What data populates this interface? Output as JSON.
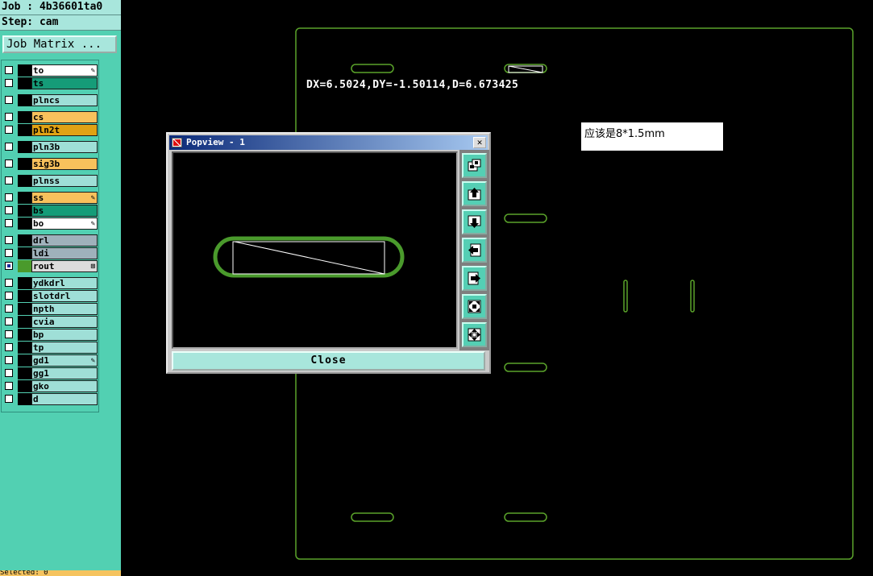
{
  "panel": {
    "job": "Job : 4b36601ta0",
    "step": "Step: cam",
    "job_matrix_label": "Job Matrix ...",
    "bottom_text": "Selected: 0"
  },
  "layers": [
    {
      "name": "to",
      "color": "#ffffff",
      "mark": "✎",
      "checked": false
    },
    {
      "name": "ts",
      "color": "#159c78",
      "mark": "",
      "checked": false
    },
    {
      "name": "plncs",
      "color": "#9fdfd7",
      "mark": "",
      "checked": false
    },
    {
      "name": "cs",
      "color": "#f8c15c",
      "mark": "",
      "checked": false
    },
    {
      "name": "pln2t",
      "color": "#e0a214",
      "mark": "",
      "checked": false
    },
    {
      "name": "pln3b",
      "color": "#9fdfd7",
      "mark": "",
      "checked": false
    },
    {
      "name": "sig3b",
      "color": "#f8c15c",
      "mark": "",
      "checked": false
    },
    {
      "name": "plnss",
      "color": "#9fdfd7",
      "mark": "",
      "checked": false
    },
    {
      "name": "ss",
      "color": "#f8c15c",
      "mark": "✎",
      "checked": false
    },
    {
      "name": "bs",
      "color": "#159c78",
      "mark": "",
      "checked": false
    },
    {
      "name": "bo",
      "color": "#ffffff",
      "mark": "✎",
      "checked": false
    },
    {
      "name": "drl",
      "color": "#9fb1bb",
      "mark": "",
      "checked": false
    },
    {
      "name": "ldi",
      "color": "#9fb1bb",
      "mark": "",
      "checked": false
    },
    {
      "name": "rout",
      "color": "#dcdcdc",
      "mark": "⊞",
      "checked": true
    },
    {
      "name": "ydkdrl",
      "color": "#9fdfd7",
      "mark": "",
      "checked": false
    },
    {
      "name": "slotdrl",
      "color": "#9fdfd7",
      "mark": "",
      "checked": false
    },
    {
      "name": "npth",
      "color": "#9fdfd7",
      "mark": "",
      "checked": false
    },
    {
      "name": "cvia",
      "color": "#9fdfd7",
      "mark": "",
      "checked": false
    },
    {
      "name": "bp",
      "color": "#9fdfd7",
      "mark": "",
      "checked": false
    },
    {
      "name": "tp",
      "color": "#9fdfd7",
      "mark": "",
      "checked": false
    },
    {
      "name": "gd1",
      "color": "#9fdfd7",
      "mark": "✎",
      "checked": false
    },
    {
      "name": "gg1",
      "color": "#9fdfd7",
      "mark": "",
      "checked": false
    },
    {
      "name": "gko",
      "color": "#9fdfd7",
      "mark": "",
      "checked": false
    },
    {
      "name": "d",
      "color": "#9fdfd7",
      "mark": "",
      "checked": false
    }
  ],
  "canvas": {
    "measurement": "DX=6.5024,DY=-1.50114,D=6.673425",
    "note": "应该是8*1.5mm",
    "outline_color": "#5aa32a"
  },
  "popview": {
    "title": "Popview - 1",
    "close_label": "Close",
    "toolbar_icons": [
      "zoom-home-icon",
      "pan-up-icon",
      "pan-down-icon",
      "pan-left-icon",
      "pan-right-icon",
      "zoom-in-icon",
      "zoom-out-icon"
    ]
  }
}
